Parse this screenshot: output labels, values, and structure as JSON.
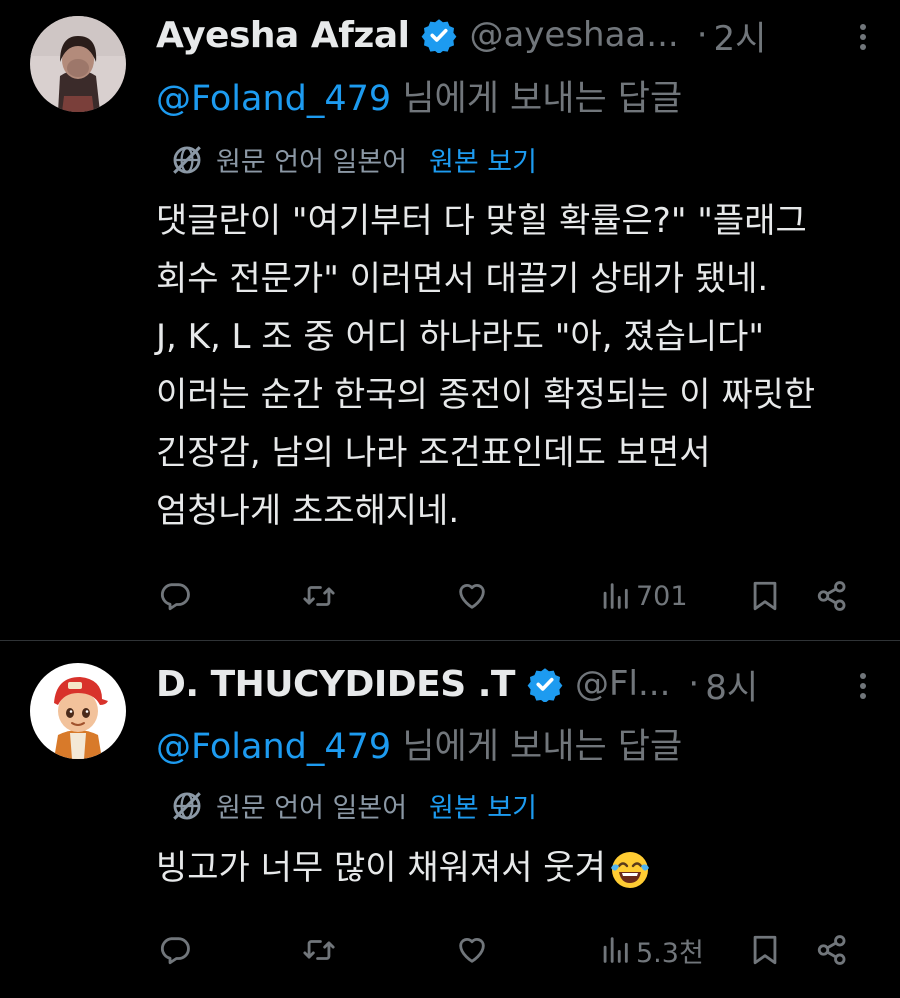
{
  "tweets": [
    {
      "author_name": "Ayesha Afzal",
      "handle": "@ayeshaa...",
      "separator": "·",
      "time": "2시",
      "reply_mention": "@Foland_479",
      "reply_suffix": " 님에게 보내는 답글",
      "translation_note": "원문 언어 일본어",
      "show_original": "원본 보기",
      "text": "댓글란이 \"여기부터 다 맞힐 확률은?\" \"플래그\n회수 전문가\" 이러면서 대끌기 상태가 됐네.\nJ, K, L 조 중 어디 하나라도 \"아, 졌습니다\"\n이러는 순간 한국의 종전이 확정되는 이 짜릿한\n긴장감, 남의 나라 조건표인데도 보면서\n엄청나게 초조해지네.",
      "views": "701"
    },
    {
      "author_name": "D. THUCYDIDES .T",
      "handle": "@Fl...",
      "separator": "·",
      "time": "8시",
      "reply_mention": "@Foland_479",
      "reply_suffix": " 님에게 보내는 답글",
      "translation_note": "원문 언어 일본어",
      "show_original": "원본 보기",
      "text": "빙고가 너무 많이 채워져서 웃겨",
      "views": "5.3천"
    }
  ],
  "icons": {
    "verified": "verified-badge-icon",
    "more": "more-vertical-icon",
    "globe": "translate-globe-icon",
    "reply": "reply-icon",
    "retweet": "retweet-icon",
    "like": "heart-icon",
    "views": "views-chart-icon",
    "bookmark": "bookmark-icon",
    "share": "share-icon",
    "emoji": "face-with-tears-of-joy-emoji"
  },
  "colors": {
    "background": "#000000",
    "text": "#e7e9ea",
    "muted": "#71767b",
    "accent": "#1d9bf0",
    "divider": "#2f3336"
  }
}
